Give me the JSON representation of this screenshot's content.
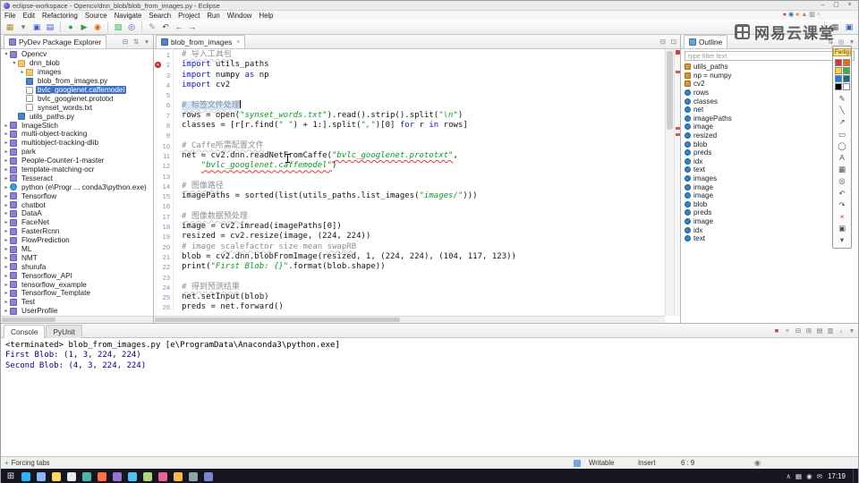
{
  "window": {
    "title": "eclipse-workspace - Opencv/dnn_blob/blob_from_images.py - Eclipse",
    "controls": [
      {
        "n": "minimize-button",
        "g": "–"
      },
      {
        "n": "maximize-button",
        "g": "▢"
      },
      {
        "n": "close-button",
        "g": "×"
      }
    ]
  },
  "menu": [
    "File",
    "Edit",
    "Refactoring",
    "Source",
    "Navigate",
    "Search",
    "Project",
    "Run",
    "Window",
    "Help"
  ],
  "overlay_icons": [
    {
      "n": "recorder-icon",
      "g": "●",
      "c": "#e03131"
    },
    {
      "n": "camera-icon",
      "g": "◉",
      "c": "#1971c2"
    },
    {
      "n": "mic-icon",
      "g": "●",
      "c": "#f08c00"
    },
    {
      "n": "up-arrow-icon",
      "g": "▲",
      "c": "#868e96"
    },
    {
      "n": "tv-icon",
      "g": "▥",
      "c": "#5f7a8a"
    },
    {
      "n": "close-overlay-icon",
      "g": "×",
      "c": "#adb5bd"
    }
  ],
  "toolbar": [
    {
      "n": "new-wizard-icon",
      "g": "▦",
      "c": "#b08d2e"
    },
    {
      "n": "new-dropdown-icon",
      "g": "▾",
      "c": "#777777"
    },
    {
      "n": "save-icon",
      "g": "▣",
      "c": "#3b5bdb"
    },
    {
      "n": "save-all-icon",
      "g": "▤",
      "c": "#3b5bdb"
    },
    {
      "sep": true
    },
    {
      "n": "debug-icon",
      "g": "●",
      "c": "#2f9e44"
    },
    {
      "n": "run-icon",
      "g": "▶",
      "c": "#2f9e44"
    },
    {
      "n": "coverage-icon",
      "g": "◉",
      "c": "#e8590c"
    },
    {
      "sep": true
    },
    {
      "n": "new-module-icon",
      "g": "▧",
      "c": "#37b24d"
    },
    {
      "n": "search-icon",
      "g": "◎",
      "c": "#5f3dc4"
    },
    {
      "sep": true
    },
    {
      "n": "annotation-icon",
      "g": "✎",
      "c": "#868e96"
    },
    {
      "n": "last-edit-icon",
      "g": "↶",
      "c": "#495057"
    },
    {
      "n": "back-icon",
      "g": "←",
      "c": "#495057"
    },
    {
      "n": "forward-icon",
      "g": "→",
      "c": "#495057"
    }
  ],
  "perspectives": [
    {
      "n": "open-perspective-icon",
      "g": "▦",
      "c": "#666666"
    },
    {
      "n": "pydev-perspective-icon",
      "g": "▣",
      "c": "#2b6cb0"
    }
  ],
  "explorer": {
    "title": "PyDev Package Explorer",
    "header_icons": [
      "⊟",
      "⇅",
      "▾"
    ],
    "items": [
      {
        "label": "Opencv",
        "depth": 0,
        "arrow": "v",
        "icon": "project"
      },
      {
        "label": "dnn_blob",
        "depth": 1,
        "arrow": "v",
        "icon": "folder"
      },
      {
        "label": "images",
        "depth": 2,
        "arrow": ">",
        "icon": "folder"
      },
      {
        "label": "blob_from_images.py",
        "depth": 2,
        "arrow": "",
        "icon": "pyfile"
      },
      {
        "label": "bvlc_googlenet.caffemodel",
        "depth": 2,
        "arrow": "",
        "icon": "file",
        "selected": true
      },
      {
        "label": "bvlc_googlenet.prototxt",
        "depth": 2,
        "arrow": "",
        "icon": "file"
      },
      {
        "label": "synset_words.txt",
        "depth": 2,
        "arrow": "",
        "icon": "file"
      },
      {
        "label": "utils_paths.py",
        "depth": 1,
        "arrow": "",
        "icon": "pyfile"
      },
      {
        "label": "ImageStich",
        "depth": 0,
        "arrow": ">",
        "icon": "project"
      },
      {
        "label": "multi-object-tracking",
        "depth": 0,
        "arrow": ">",
        "icon": "project"
      },
      {
        "label": "multiobject-tracking-dlib",
        "depth": 0,
        "arrow": ">",
        "icon": "project"
      },
      {
        "label": "park",
        "depth": 0,
        "arrow": ">",
        "icon": "project"
      },
      {
        "label": "People-Counter-1-master",
        "depth": 0,
        "arrow": ">",
        "icon": "project"
      },
      {
        "label": "template-matching-ocr",
        "depth": 0,
        "arrow": ">",
        "icon": "project"
      },
      {
        "label": "Tesseract",
        "depth": 0,
        "arrow": ">",
        "icon": "project"
      },
      {
        "label": "python (e\\Progr ... conda3\\python.exe)",
        "depth": 0,
        "arrow": ">",
        "icon": "python"
      },
      {
        "label": "Tensorflow",
        "depth": 0,
        "arrow": ">",
        "icon": "project"
      },
      {
        "label": "chatbot",
        "depth": 0,
        "arrow": ">",
        "icon": "project"
      },
      {
        "label": "DataA",
        "depth": 0,
        "arrow": ">",
        "icon": "project"
      },
      {
        "label": "FaceNet",
        "depth": 0,
        "arrow": ">",
        "icon": "project"
      },
      {
        "label": "FasterRcnn",
        "depth": 0,
        "arrow": ">",
        "icon": "project"
      },
      {
        "label": "FlowPrediction",
        "depth": 0,
        "arrow": ">",
        "icon": "project"
      },
      {
        "label": "ML",
        "depth": 0,
        "arrow": ">",
        "icon": "project"
      },
      {
        "label": "NMT",
        "depth": 0,
        "arrow": ">",
        "icon": "project"
      },
      {
        "label": "shurufa",
        "depth": 0,
        "arrow": ">",
        "icon": "project"
      },
      {
        "label": "Tensorflow_API",
        "depth": 0,
        "arrow": ">",
        "icon": "project"
      },
      {
        "label": "tensorflow_example",
        "depth": 0,
        "arrow": ">",
        "icon": "project"
      },
      {
        "label": "Tensorflow_Template",
        "depth": 0,
        "arrow": ">",
        "icon": "project"
      },
      {
        "label": "Test",
        "depth": 0,
        "arrow": ">",
        "icon": "project"
      },
      {
        "label": "UserProfile",
        "depth": 0,
        "arrow": ">",
        "icon": "project"
      }
    ]
  },
  "editor": {
    "tab": "blob_from_images",
    "tab_close": "×",
    "markers": [
      2,
      11,
      12
    ],
    "lines": [
      {
        "n": 1,
        "segs": [
          {
            "t": "# 导入工具包",
            "c": "cw"
          }
        ]
      },
      {
        "n": 2,
        "err": true,
        "segs": [
          {
            "t": "import",
            "c": "k"
          },
          {
            "t": " utils_paths",
            "c": "d"
          }
        ]
      },
      {
        "n": 3,
        "segs": [
          {
            "t": "import",
            "c": "k"
          },
          {
            "t": " numpy ",
            "c": "d"
          },
          {
            "t": "as",
            "c": "k"
          },
          {
            "t": " np",
            "c": "d"
          }
        ]
      },
      {
        "n": 4,
        "segs": [
          {
            "t": "import",
            "c": "k"
          },
          {
            "t": " cv2",
            "c": "d"
          }
        ]
      },
      {
        "n": 5,
        "segs": []
      },
      {
        "n": 6,
        "cursor": true,
        "segs": [
          {
            "t": "# 标签文件处理",
            "c": "cw hl"
          }
        ]
      },
      {
        "n": 7,
        "segs": [
          {
            "t": "rows = open(",
            "c": "d"
          },
          {
            "t": "\"synset_words.txt\"",
            "c": "s"
          },
          {
            "t": ").read().strip().split(",
            "c": "d"
          },
          {
            "t": "\"\\n\"",
            "c": "s"
          },
          {
            "t": ")",
            "c": "d"
          }
        ]
      },
      {
        "n": 8,
        "segs": [
          {
            "t": "classes = [r[r.find(",
            "c": "d"
          },
          {
            "t": "\" \"",
            "c": "s"
          },
          {
            "t": ") + 1:].split(",
            "c": "d"
          },
          {
            "t": "\",\"",
            "c": "s"
          },
          {
            "t": ")[0] ",
            "c": "d"
          },
          {
            "t": "for",
            "c": "k"
          },
          {
            "t": " r ",
            "c": "d"
          },
          {
            "t": "in",
            "c": "k"
          },
          {
            "t": " rows]",
            "c": "d"
          }
        ]
      },
      {
        "n": 9,
        "segs": []
      },
      {
        "n": 10,
        "segs": [
          {
            "t": "# Caffe所需配置文件",
            "c": "cw"
          }
        ]
      },
      {
        "n": 11,
        "segs": [
          {
            "t": "net = cv2.dnn.readNetFromCaffe(",
            "c": "d"
          },
          {
            "t": "\"bvlc_googlenet.prototxt\"",
            "c": "sr"
          },
          {
            "t": ",",
            "c": "d"
          }
        ]
      },
      {
        "n": 12,
        "segs": [
          {
            "t": "    ",
            "c": "d"
          },
          {
            "t": "\"bvlc_googlenet.caffemodel\"",
            "c": "sr"
          },
          {
            "t": ")",
            "c": "d"
          }
        ]
      },
      {
        "n": 13,
        "segs": []
      },
      {
        "n": 14,
        "segs": [
          {
            "t": "# 图像路径",
            "c": "cw"
          }
        ]
      },
      {
        "n": 15,
        "segs": [
          {
            "t": "imagePaths = sorted(list(utils_paths.list_images(",
            "c": "d"
          },
          {
            "t": "\"images/\"",
            "c": "s"
          },
          {
            "t": ")))",
            "c": "d"
          }
        ]
      },
      {
        "n": 16,
        "segs": []
      },
      {
        "n": 17,
        "segs": [
          {
            "t": "# 图像数据预处理",
            "c": "cw"
          }
        ]
      },
      {
        "n": 18,
        "segs": [
          {
            "t": "image = cv2.imread(imagePaths[",
            "c": "d"
          },
          {
            "t": "0",
            "c": "nm"
          },
          {
            "t": "])",
            "c": "d"
          }
        ]
      },
      {
        "n": 19,
        "segs": [
          {
            "t": "resized = cv2.resize(image, (",
            "c": "d"
          },
          {
            "t": "224",
            "c": "nm"
          },
          {
            "t": ", ",
            "c": "d"
          },
          {
            "t": "224",
            "c": "nm"
          },
          {
            "t": "))",
            "c": "d"
          }
        ]
      },
      {
        "n": 20,
        "segs": [
          {
            "t": "# image ",
            "c": "c"
          },
          {
            "t": "scalefactor",
            "c": "cw"
          },
          {
            "t": " size mean ",
            "c": "c"
          },
          {
            "t": "swapRB",
            "c": "cw"
          }
        ]
      },
      {
        "n": 21,
        "segs": [
          {
            "t": "blob = cv2.dnn.blobFromImage(resized, ",
            "c": "d"
          },
          {
            "t": "1",
            "c": "nm"
          },
          {
            "t": ", (",
            "c": "d"
          },
          {
            "t": "224",
            "c": "nm"
          },
          {
            "t": ", ",
            "c": "d"
          },
          {
            "t": "224",
            "c": "nm"
          },
          {
            "t": "), (",
            "c": "d"
          },
          {
            "t": "104",
            "c": "nm"
          },
          {
            "t": ", ",
            "c": "d"
          },
          {
            "t": "117",
            "c": "nm"
          },
          {
            "t": ", ",
            "c": "d"
          },
          {
            "t": "123",
            "c": "nm"
          },
          {
            "t": "))",
            "c": "d"
          }
        ]
      },
      {
        "n": 22,
        "segs": [
          {
            "t": "print(",
            "c": "d"
          },
          {
            "t": "\"First Blob: {}\"",
            "c": "s"
          },
          {
            "t": ".format(blob.shape))",
            "c": "d"
          }
        ]
      },
      {
        "n": 23,
        "segs": []
      },
      {
        "n": 24,
        "segs": [
          {
            "t": "# 得到预测结果",
            "c": "cw"
          }
        ]
      },
      {
        "n": 25,
        "segs": [
          {
            "t": "net.setInput(blob)",
            "c": "d"
          }
        ]
      },
      {
        "n": 26,
        "segs": [
          {
            "t": "preds = net.forward()",
            "c": "d"
          }
        ]
      }
    ]
  },
  "outline": {
    "title": "Outline",
    "filter": "type filter text",
    "header_icons": [
      "⇅",
      "◎",
      "▾"
    ],
    "items": [
      {
        "label": "utils_paths",
        "icon": "import"
      },
      {
        "label": "np = numpy",
        "icon": "import"
      },
      {
        "label": "cv2",
        "icon": "import"
      },
      {
        "label": "rows",
        "icon": "var"
      },
      {
        "label": "classes",
        "icon": "var"
      },
      {
        "label": "net",
        "icon": "var"
      },
      {
        "label": "imagePaths",
        "icon": "var"
      },
      {
        "label": "image",
        "icon": "var"
      },
      {
        "label": "resized",
        "icon": "var"
      },
      {
        "label": "blob",
        "icon": "var"
      },
      {
        "label": "preds",
        "icon": "var"
      },
      {
        "label": "idx",
        "icon": "var"
      },
      {
        "label": "text",
        "icon": "var"
      },
      {
        "label": "images",
        "icon": "var"
      },
      {
        "label": "image",
        "icon": "var"
      },
      {
        "label": "image",
        "icon": "var"
      },
      {
        "label": "blob",
        "icon": "var"
      },
      {
        "label": "preds",
        "icon": "var"
      },
      {
        "label": "image",
        "icon": "var"
      },
      {
        "label": "idx",
        "icon": "var"
      },
      {
        "label": "text",
        "icon": "var"
      }
    ]
  },
  "console": {
    "tabs": [
      {
        "label": "Console",
        "active": true
      },
      {
        "label": "PyUnit",
        "active": false
      }
    ],
    "icons": [
      "■",
      "×",
      "⊟",
      "⊞",
      "▤",
      "▥",
      "↓",
      "▾"
    ],
    "terminated": "<terminated> blob_from_images.py [e\\ProgramData\\Anaconda3\\python.exe]",
    "output": [
      "First Blob: (1, 3, 224, 224)",
      "Second Blob: (4, 3, 224, 224)"
    ]
  },
  "statusbar": {
    "left_icon": "+",
    "left": "Forcing tabs",
    "writable": "Writable",
    "mode": "Insert",
    "position": "6 : 9"
  },
  "taskbar": {
    "start": "⊞",
    "apps": [
      {
        "c": "#29b6f6"
      },
      {
        "c": "#8ab4f8"
      },
      {
        "c": "#fdd663"
      },
      {
        "c": "#e8eaed"
      },
      {
        "c": "#4db6ac"
      },
      {
        "c": "#ff7043"
      },
      {
        "c": "#9575cd"
      },
      {
        "c": "#4fc3f7"
      },
      {
        "c": "#aed581"
      },
      {
        "c": "#f06292"
      },
      {
        "c": "#ffb74d"
      },
      {
        "c": "#90a4ae"
      },
      {
        "c": "#7986cb"
      }
    ],
    "tray": [
      "∧",
      "▦",
      "◉",
      "✉"
    ],
    "time": "17:19"
  },
  "watermark": {
    "text": "网易云课堂"
  },
  "annotator": {
    "done": "Fertig",
    "colors": [
      "#e03131",
      "#f76707",
      "#ffd43b",
      "#37b24d",
      "#1c7ed6",
      "#0b7285",
      "#000000",
      "#ffffff"
    ],
    "tools": [
      {
        "n": "pen-icon",
        "g": "✎"
      },
      {
        "n": "line-icon",
        "g": "╲"
      },
      {
        "n": "arrow-icon",
        "g": "↗"
      },
      {
        "n": "rect-icon",
        "g": "▭"
      },
      {
        "n": "ellipse-icon",
        "g": "◯"
      },
      {
        "n": "text-icon",
        "g": "A"
      },
      {
        "n": "mosaic-icon",
        "g": "▦"
      },
      {
        "n": "magnifier-icon",
        "g": "◎"
      },
      {
        "n": "undo-icon",
        "g": "↶"
      },
      {
        "n": "redo-icon",
        "g": "↷"
      },
      {
        "n": "delete-icon",
        "g": "×"
      },
      {
        "n": "save-icon",
        "g": "▣"
      },
      {
        "n": "collapse-icon",
        "g": "▾"
      }
    ]
  }
}
